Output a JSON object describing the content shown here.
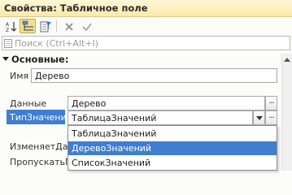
{
  "window": {
    "title": "Свойства: Табличное поле"
  },
  "toolbar": {
    "buttons": [
      {
        "name": "sort-az-icon"
      },
      {
        "name": "view-categories-icon"
      },
      {
        "name": "filter-icon"
      },
      {
        "name": "clear-icon"
      },
      {
        "name": "apply-icon"
      }
    ]
  },
  "search": {
    "placeholder": "Поиск (Ctrl+Alt+I)"
  },
  "group": {
    "title": "Основные:"
  },
  "fields": {
    "name": {
      "label": "Имя",
      "value": "Дерево"
    },
    "data": {
      "label": "Данные",
      "value": "Дерево",
      "button": "..."
    },
    "type": {
      "label": "ТипЗначения",
      "value": "ТаблицаЗначений",
      "button": "..."
    }
  },
  "hidden_rows": [
    {
      "label": "ИзменяетДан"
    },
    {
      "label": "ПропускатьП"
    },
    {
      "label": ""
    }
  ],
  "dropdown": {
    "options": [
      "ТаблицаЗначений",
      "ДеревоЗначений",
      "СписокЗначений"
    ],
    "highlighted": "ДеревоЗначений"
  },
  "colors": {
    "accent": "#3f7ed0",
    "title_bg": "#fbe9a8"
  }
}
